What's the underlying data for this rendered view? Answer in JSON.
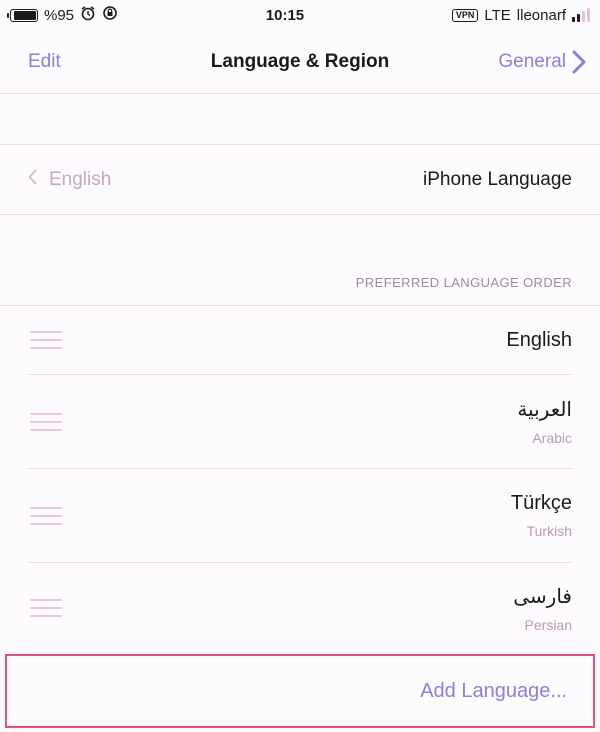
{
  "status_bar": {
    "battery_percent": "%95",
    "battery_level": 0.95,
    "time": "10:15",
    "vpn": "VPN",
    "network": "LTE",
    "carrier": "lleonarf"
  },
  "nav": {
    "edit_label": "Edit",
    "title": "Language & Region",
    "back_label": "General"
  },
  "iphone_language": {
    "label": "iPhone Language",
    "value": "English"
  },
  "preferred": {
    "header": "PREFERRED LANGUAGE ORDER",
    "items": [
      {
        "name": "English",
        "sub": ""
      },
      {
        "name": "العربية",
        "sub": "Arabic"
      },
      {
        "name": "Türkçe",
        "sub": "Turkish"
      },
      {
        "name": "فارسی",
        "sub": "Persian"
      }
    ]
  },
  "add_language_label": "Add Language...",
  "colors": {
    "accent": "#8a7fe0",
    "highlight_border": "#e0527f",
    "separator": "#efdce9"
  },
  "icons": [
    "battery-icon",
    "alarm-icon",
    "rotation-lock-icon",
    "vpn-badge",
    "signal-icon",
    "chevron-left-icon",
    "chevron-right-icon",
    "drag-handle-icon"
  ]
}
